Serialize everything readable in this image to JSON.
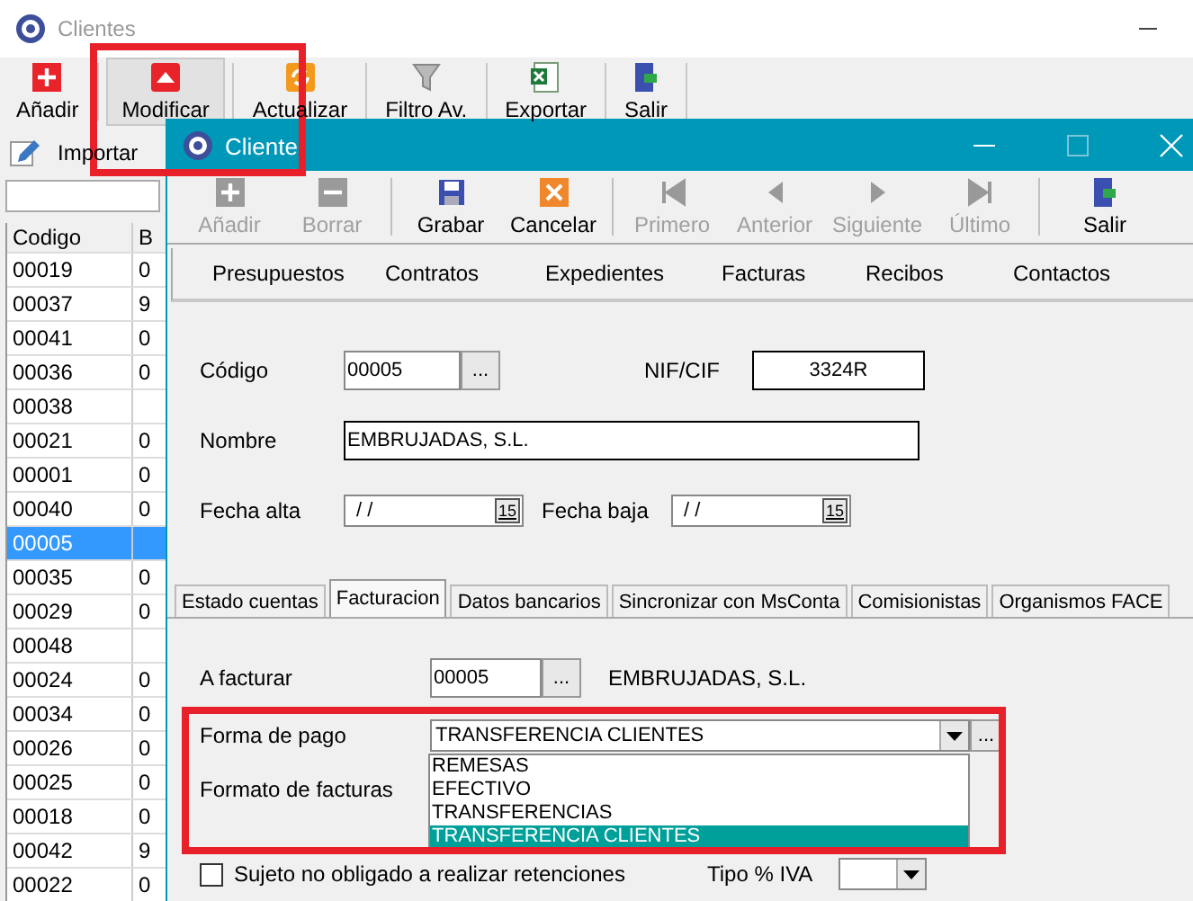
{
  "background_window": {
    "title": "Clientes",
    "toolbar": [
      {
        "label": "Añadir",
        "kind": "add",
        "pressed": false
      },
      {
        "label": "Modificar",
        "kind": "edit",
        "pressed": true
      },
      {
        "label": "Actualizar",
        "kind": "refresh",
        "pressed": false
      },
      {
        "label": "Filtro Av.",
        "kind": "filter",
        "pressed": false
      },
      {
        "label": "Exportar",
        "kind": "sheet",
        "pressed": false
      },
      {
        "label": "Salir",
        "kind": "exit",
        "pressed": false
      }
    ],
    "secondary_toolbar": [
      {
        "label": "Importar",
        "kind": "pencil"
      }
    ],
    "grid": {
      "columns": [
        "Codigo",
        "B"
      ],
      "rows": [
        {
          "cells": [
            "00019",
            "0"
          ],
          "selected": false
        },
        {
          "cells": [
            "00037",
            "9"
          ],
          "selected": false
        },
        {
          "cells": [
            "00041",
            "0"
          ],
          "selected": false
        },
        {
          "cells": [
            "00036",
            "0"
          ],
          "selected": false
        },
        {
          "cells": [
            "00038",
            ""
          ],
          "selected": false
        },
        {
          "cells": [
            "00021",
            "0"
          ],
          "selected": false
        },
        {
          "cells": [
            "00001",
            "0"
          ],
          "selected": false
        },
        {
          "cells": [
            "00040",
            "0"
          ],
          "selected": false
        },
        {
          "cells": [
            "00005",
            ""
          ],
          "selected": true
        },
        {
          "cells": [
            "00035",
            "0"
          ],
          "selected": false
        },
        {
          "cells": [
            "00029",
            "0"
          ],
          "selected": false
        },
        {
          "cells": [
            "00048",
            ""
          ],
          "selected": false
        },
        {
          "cells": [
            "00024",
            "0"
          ],
          "selected": false
        },
        {
          "cells": [
            "00034",
            "0"
          ],
          "selected": false
        },
        {
          "cells": [
            "00026",
            "0"
          ],
          "selected": false
        },
        {
          "cells": [
            "00025",
            "0"
          ],
          "selected": false
        },
        {
          "cells": [
            "00018",
            "0"
          ],
          "selected": false
        },
        {
          "cells": [
            "00042",
            "9"
          ],
          "selected": false
        },
        {
          "cells": [
            "00022",
            "0"
          ],
          "selected": false
        }
      ]
    }
  },
  "dialog": {
    "title": "Cliente",
    "toolbar": [
      {
        "label": "Añadir",
        "kind": "add",
        "disabled": true
      },
      {
        "label": "Borrar",
        "kind": "remove",
        "disabled": true
      },
      {
        "label": "Grabar",
        "kind": "save",
        "disabled": false
      },
      {
        "label": "Cancelar",
        "kind": "cancel",
        "disabled": false
      },
      {
        "label": "Primero",
        "kind": "first",
        "disabled": true
      },
      {
        "label": "Anterior",
        "kind": "prev",
        "disabled": true
      },
      {
        "label": "Siguiente",
        "kind": "next",
        "disabled": true
      },
      {
        "label": "Último",
        "kind": "last",
        "disabled": true
      },
      {
        "label": "Salir",
        "kind": "exit",
        "disabled": false
      }
    ],
    "sections": [
      "Presupuestos",
      "Contratos",
      "Expedientes",
      "Facturas",
      "Recibos",
      "Contactos"
    ],
    "codigo": {
      "label": "Código",
      "value": "00005",
      "browse": "..."
    },
    "nif": {
      "label": "NIF/CIF",
      "value": "3324R"
    },
    "nombre": {
      "label": "Nombre",
      "value": "EMBRUJADAS, S.L."
    },
    "fecha_alta": {
      "label": "Fecha alta",
      "value": "/ /",
      "calendar": "15"
    },
    "fecha_baja": {
      "label": "Fecha baja",
      "value": "/ /",
      "calendar": "15"
    },
    "tabs": [
      {
        "label": "Estado cuentas",
        "selected": false
      },
      {
        "label": "Facturacion",
        "selected": true
      },
      {
        "label": "Datos bancarios",
        "selected": false
      },
      {
        "label": "Sincronizar con MsConta",
        "selected": false
      },
      {
        "label": "Comisionistas",
        "selected": false
      },
      {
        "label": "Organismos FACE",
        "selected": false
      }
    ],
    "a_facturar": {
      "label": "A facturar",
      "value": "00005",
      "browse": "...",
      "name": "EMBRUJADAS, S.L."
    },
    "forma_pago": {
      "label": "Forma de pago",
      "value": "TRANSFERENCIA CLIENTES",
      "browse": "...",
      "options": [
        {
          "label": "REMESAS",
          "selected": false
        },
        {
          "label": "EFECTIVO",
          "selected": false
        },
        {
          "label": "TRANSFERENCIAS",
          "selected": false
        },
        {
          "label": "TRANSFERENCIA CLIENTES",
          "selected": true
        }
      ]
    },
    "formato_facturas": {
      "label": "Formato de facturas"
    },
    "retenciones": {
      "label": "Sujeto no obligado a realizar retenciones",
      "checked": false
    },
    "tipo_iva": {
      "label": "Tipo % IVA"
    }
  }
}
